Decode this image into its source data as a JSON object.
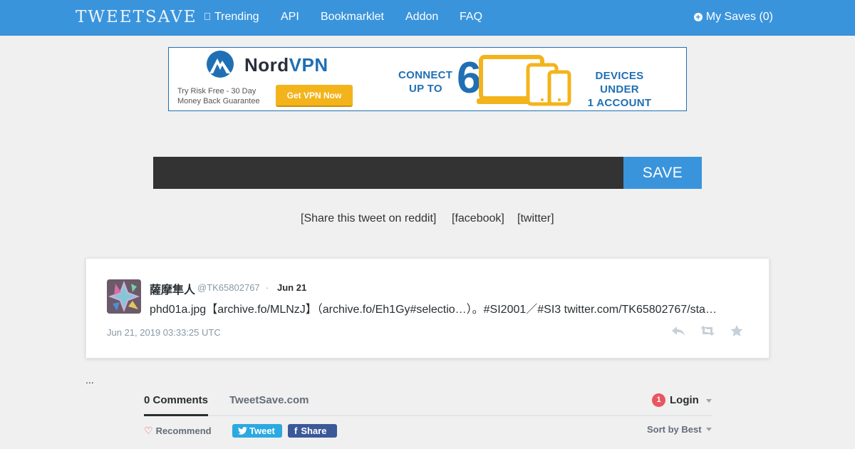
{
  "nav": {
    "logo": "TWEETSAVE",
    "items": [
      "Trending",
      "API",
      "Bookmarklet",
      "Addon",
      "FAQ"
    ],
    "my_saves": "My Saves (0)",
    "trending_icon": "square-icon",
    "saves_icon": "plus-circle-icon"
  },
  "ad": {
    "brand_a": "Nord",
    "brand_b": "VPN",
    "risk_line1": "Try Risk Free - 30 Day",
    "risk_line2": "Money Back Guarantee",
    "cta": "Get VPN Now",
    "connect_line1": "CONNECT",
    "connect_line2": "UP TO",
    "count": "6",
    "devices_line1": "DEVICES UNDER",
    "devices_line2": "1 ACCOUNT"
  },
  "save_form": {
    "input_value": "",
    "button": "SAVE"
  },
  "share": {
    "reddit": "[Share this tweet on reddit]",
    "facebook": "[facebook]",
    "twitter": "[twitter]"
  },
  "tweet": {
    "name": "薩摩隼人",
    "handle": "@TK65802767",
    "separator": "·",
    "date": "Jun 21",
    "text": "phd01a.jpg【archive.fo/MLNzJ】（archive.fo/Eh1Gy#selectio…）。#SI2001／#SI3 twitter.com/TK65802767/sta…",
    "timestamp": "Jun 21, 2019 03:33:25 UTC",
    "actions": [
      "reply-icon",
      "retweet-icon",
      "favorite-icon"
    ]
  },
  "ellipsis": "...",
  "comments": {
    "tab_comments": "0 Comments",
    "tab_site": "TweetSave.com",
    "notification_count": "1",
    "login": "Login",
    "recommend": "Recommend",
    "tweet_btn": "Tweet",
    "share_btn": "Share",
    "sort": "Sort by Best"
  },
  "colors": {
    "accent": "#3a94dc",
    "dark_input": "#333333",
    "ad_yellow": "#f3b41b",
    "ad_blue": "#1f6fb5"
  }
}
